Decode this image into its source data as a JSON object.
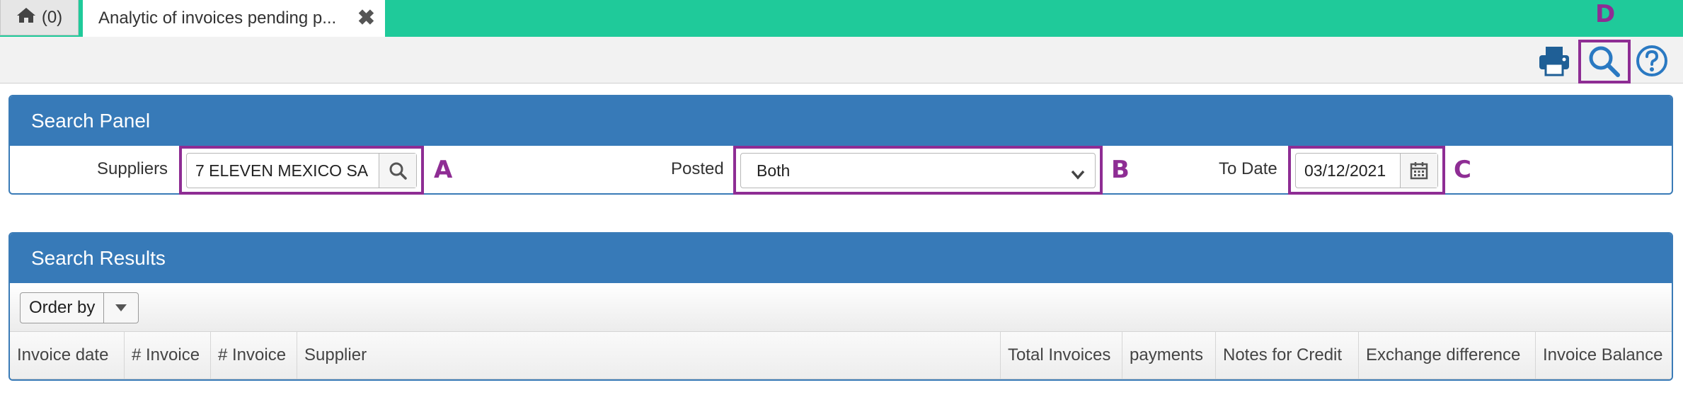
{
  "tabs": {
    "home_count": "(0)",
    "active_title": "Analytic of invoices pending p...",
    "close_symbol": "✖"
  },
  "toolbar": {
    "print_icon": "printer-icon",
    "search_icon": "search-icon",
    "help_icon": "help-circle-icon",
    "search_marker": "D"
  },
  "search_panel": {
    "title": "Search Panel",
    "suppliers": {
      "label": "Suppliers",
      "value": "7 ELEVEN MEXICO SA D",
      "marker": "A"
    },
    "posted": {
      "label": "Posted",
      "value": "Both",
      "marker": "B"
    },
    "to_date": {
      "label": "To Date",
      "value": "03/12/2021",
      "marker": "C"
    }
  },
  "results_panel": {
    "title": "Search Results",
    "order_by_label": "Order by",
    "columns": [
      "Invoice date",
      "# Invoice",
      "# Invoice",
      "Supplier",
      "Total Invoices",
      "payments",
      "Notes for Credit",
      "Exchange difference",
      "Invoice Balance"
    ]
  },
  "colors": {
    "tabbar": "#1fca9a",
    "panel_header": "#377ab8",
    "highlight": "#8e2d94"
  }
}
